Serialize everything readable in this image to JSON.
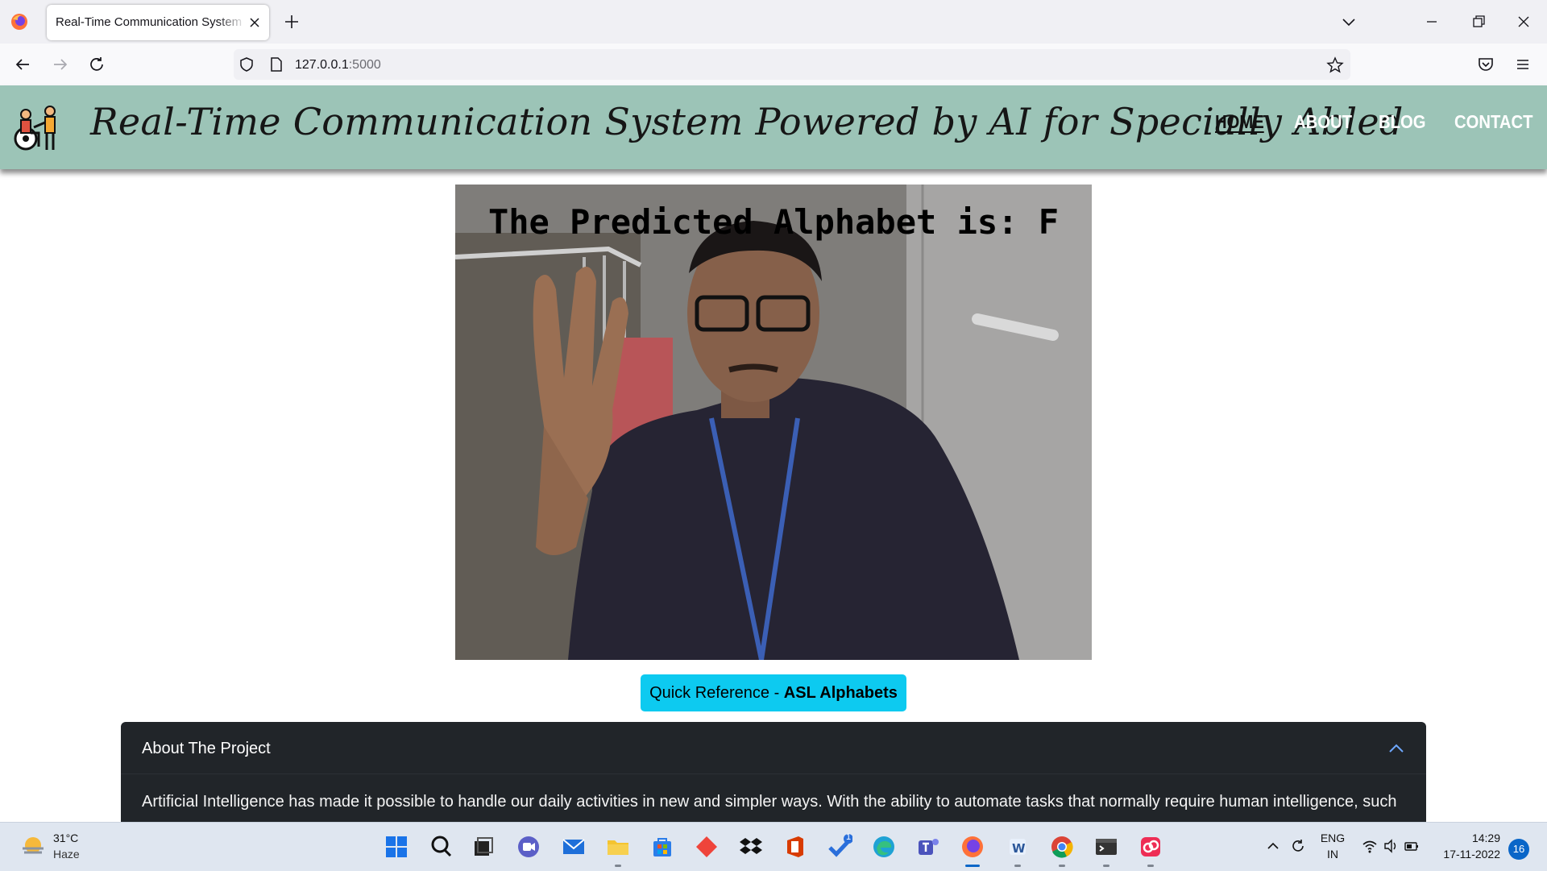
{
  "browser": {
    "tab_title": "Real-Time Communication System Powered by AI for Specially Abled",
    "url_host": "127.0.0.1",
    "url_port": ":5000"
  },
  "site": {
    "title": "Real-Time Communication System Powered by AI for Specially Abled",
    "nav": {
      "home": "HOME",
      "about": "ABOUT",
      "blog": "BLOG",
      "contact": "CONTACT"
    },
    "prediction_text": "The Predicted Alphabet is: F",
    "quick_ref": {
      "prefix": "Quick Reference - ",
      "bold": "ASL Alphabets"
    },
    "accordion": {
      "header": "About The Project",
      "body": "Artificial Intelligence has made it possible to handle our daily activities in new and simpler ways. With the ability to automate tasks that normally require human intelligence, such"
    }
  },
  "taskbar": {
    "weather_temp": "31°C",
    "weather_desc": "Haze",
    "badge_count": "1",
    "lang_top": "ENG",
    "lang_bottom": "IN",
    "time": "14:29",
    "date": "17-11-2022",
    "notification_count": "16"
  },
  "colors": {
    "header_bg": "#9cc4b7",
    "button_bg": "#0dcaf0",
    "accordion_bg": "#212529"
  }
}
